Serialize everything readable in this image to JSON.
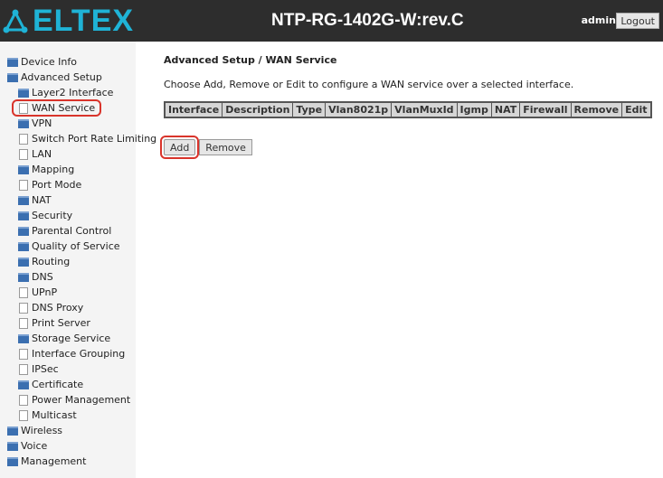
{
  "header": {
    "logo": "ELTEX",
    "title": "NTP-RG-1402G-W:rev.C",
    "user": "admin",
    "logout_label": "Logout"
  },
  "sidebar": {
    "items": [
      {
        "label": "Device Info",
        "icon": "folder",
        "level": 0
      },
      {
        "label": "Advanced Setup",
        "icon": "folder",
        "level": 0
      },
      {
        "label": "Layer2 Interface",
        "icon": "folder",
        "level": 1
      },
      {
        "label": "WAN Service",
        "icon": "page",
        "level": 1,
        "selected": true
      },
      {
        "label": "VPN",
        "icon": "folder",
        "level": 1
      },
      {
        "label": "Switch Port Rate Limiting",
        "icon": "page",
        "level": 1
      },
      {
        "label": "LAN",
        "icon": "page",
        "level": 1
      },
      {
        "label": "Mapping",
        "icon": "folder",
        "level": 1
      },
      {
        "label": "Port Mode",
        "icon": "page",
        "level": 1
      },
      {
        "label": "NAT",
        "icon": "folder",
        "level": 1
      },
      {
        "label": "Security",
        "icon": "folder",
        "level": 1
      },
      {
        "label": "Parental Control",
        "icon": "folder",
        "level": 1
      },
      {
        "label": "Quality of Service",
        "icon": "folder",
        "level": 1
      },
      {
        "label": "Routing",
        "icon": "folder",
        "level": 1
      },
      {
        "label": "DNS",
        "icon": "folder",
        "level": 1
      },
      {
        "label": "UPnP",
        "icon": "page",
        "level": 1
      },
      {
        "label": "DNS Proxy",
        "icon": "page",
        "level": 1
      },
      {
        "label": "Print Server",
        "icon": "page",
        "level": 1
      },
      {
        "label": "Storage Service",
        "icon": "folder",
        "level": 1
      },
      {
        "label": "Interface Grouping",
        "icon": "page",
        "level": 1
      },
      {
        "label": "IPSec",
        "icon": "page",
        "level": 1
      },
      {
        "label": "Certificate",
        "icon": "folder",
        "level": 1
      },
      {
        "label": "Power Management",
        "icon": "page",
        "level": 1
      },
      {
        "label": "Multicast",
        "icon": "page",
        "level": 1
      },
      {
        "label": "Wireless",
        "icon": "folder",
        "level": 0
      },
      {
        "label": "Voice",
        "icon": "folder",
        "level": 0
      },
      {
        "label": "Management",
        "icon": "folder",
        "level": 0
      }
    ]
  },
  "main": {
    "heading": "Advanced Setup / WAN Service",
    "description": "Choose Add, Remove or Edit to configure a WAN service over a selected interface.",
    "columns": [
      "Interface",
      "Description",
      "Type",
      "Vlan8021p",
      "VlanMuxId",
      "Igmp",
      "NAT",
      "Firewall",
      "Remove",
      "Edit"
    ],
    "add_label": "Add",
    "remove_label": "Remove"
  },
  "colors": {
    "header_bg": "#2d2d2d",
    "logo": "#1fb3d6",
    "highlight": "#d9342b"
  }
}
